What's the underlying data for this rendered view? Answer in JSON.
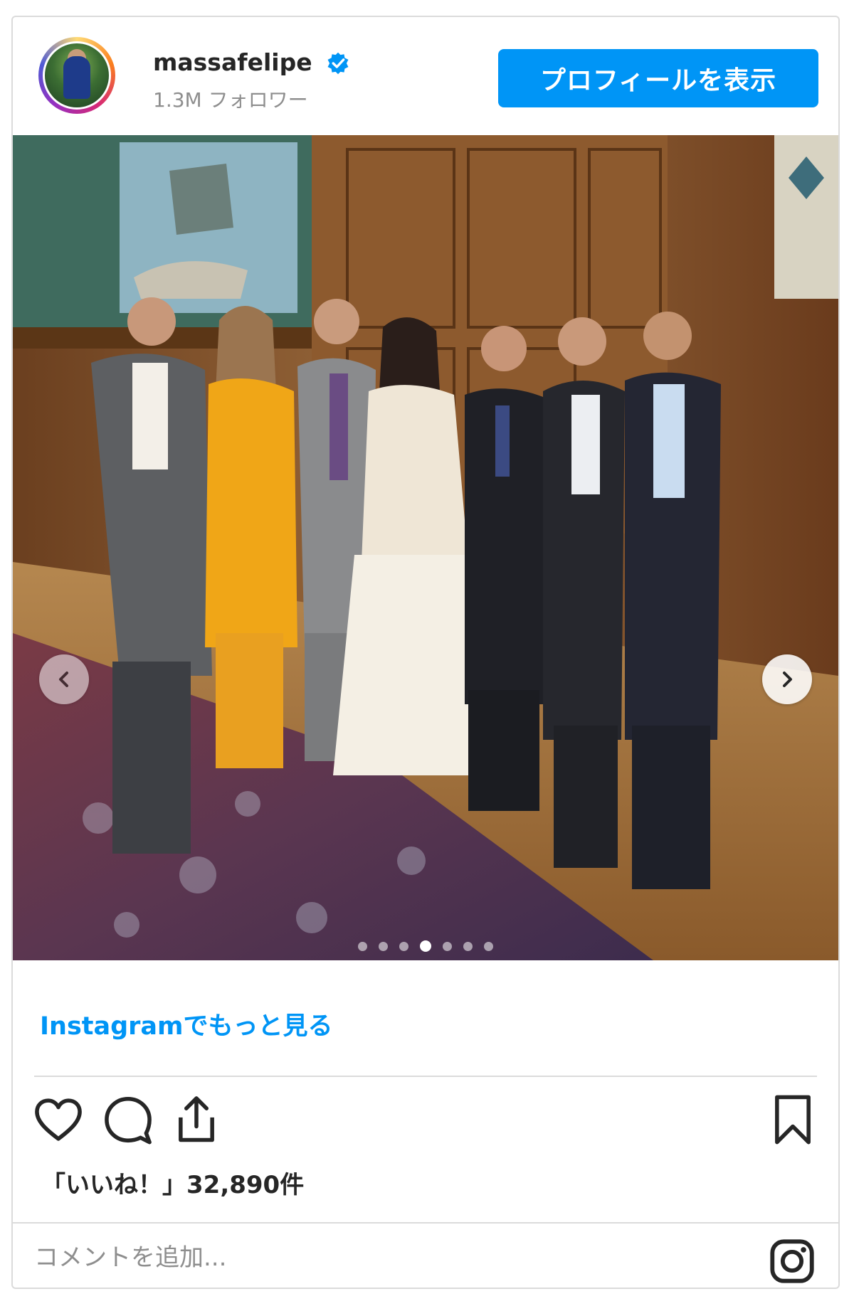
{
  "post": {
    "username": "massafelipe",
    "followers": "1.3M フォロワー",
    "view_profile_label": "プロフィールを表示",
    "photo_description_icon": "carousel-photo",
    "carousel": {
      "total_dots": 7,
      "active_index": 3
    },
    "more_link": "Instagramでもっと見る",
    "likes_text": "「いいね！」32,890件",
    "comment_placeholder": "コメントを追加...",
    "icons": {
      "verified": "verified-badge-icon",
      "like": "heart-icon",
      "comment": "comment-bubble-icon",
      "share": "share-upload-icon",
      "save": "bookmark-icon",
      "instagram": "instagram-logo-icon",
      "prev": "chevron-left-icon",
      "next": "chevron-right-icon"
    },
    "colors": {
      "accent": "#0095f6",
      "text": "#262626",
      "muted": "#8e8e8e",
      "border": "#dbdbdb"
    }
  }
}
